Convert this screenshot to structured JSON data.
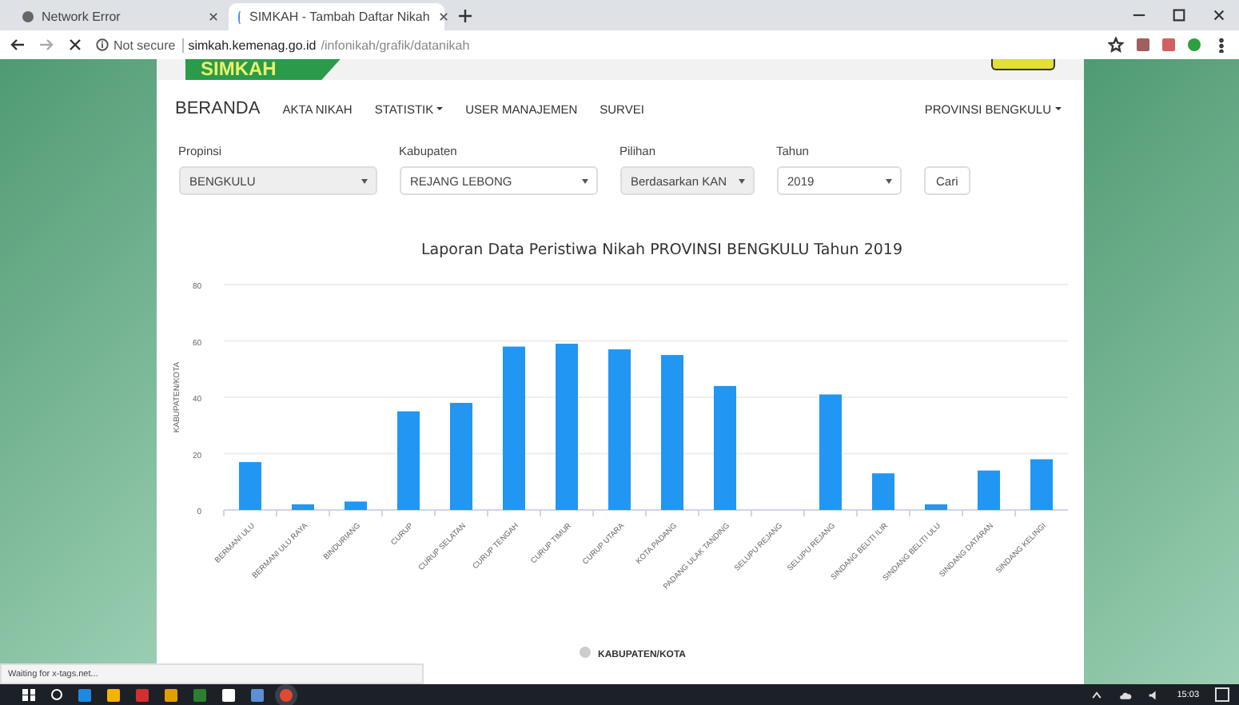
{
  "browser": {
    "tabs": [
      {
        "label": "Network Error",
        "selected": false
      },
      {
        "label": "SIMKAH - Tambah Daftar Nikah",
        "selected": true
      }
    ],
    "security": "Not secure",
    "url_host": "simkah.kemenag.go.id",
    "url_path": "/infonikah/grafik/datanikah"
  },
  "logo": "SIMKAH",
  "nav": {
    "items": [
      {
        "label": "BERANDA",
        "kind": "brand"
      },
      {
        "label": "AKTA NIKAH",
        "kind": "link"
      },
      {
        "label": "STATISTIK",
        "kind": "dropdown"
      },
      {
        "label": "USER MANAJEMEN",
        "kind": "link"
      },
      {
        "label": "SURVEI",
        "kind": "link"
      }
    ],
    "account": "PROVINSI BENGKULU"
  },
  "filters": [
    {
      "label": "Propinsi",
      "value": "BENGKULU",
      "disabled": true
    },
    {
      "label": "Kabupaten",
      "value": "REJANG LEBONG",
      "disabled": false
    },
    {
      "label": "Pilihan",
      "value": "Berdasarkan KAN",
      "disabled": true
    },
    {
      "label": "Tahun",
      "value": "2019",
      "disabled": false
    }
  ],
  "search_button": "Cari",
  "chart": {
    "chart_data": {
      "type": "bar",
      "title": "Laporan Data Peristiwa Nikah PROVINSI BENGKULU Tahun 2019",
      "ylabel": "KABUPATEN/KOTA",
      "categories": [
        "BERMANI ULU",
        "BERMANI ULU RAYA",
        "BINDURIANG",
        "CURUP",
        "CURUP SELATAN",
        "CURUP TENGAH",
        "CURUP TIMUR",
        "CURUP UTARA",
        "KOTA PADANG",
        "PADANG ULAK TANDING",
        "SELUPU REJANG",
        "SELUPU REJANG",
        "SINDANG BELITI ILIR",
        "SINDANG BELITI ULU",
        "SINDANG DATARAN",
        "SINDANG KELINGI"
      ],
      "series": [
        {
          "name": "KABUPATEN/KOTA",
          "color": "#2196f3",
          "values": [
            17,
            2,
            3,
            35,
            38,
            58,
            59,
            57,
            55,
            44,
            0,
            41,
            13,
            2,
            14,
            18
          ]
        }
      ],
      "ylim": [
        0,
        80
      ],
      "yticks": [
        0,
        20,
        40,
        60,
        80
      ],
      "grid": true
    }
  },
  "status_text": "Waiting for x-tags.net...",
  "clock": "15:03"
}
